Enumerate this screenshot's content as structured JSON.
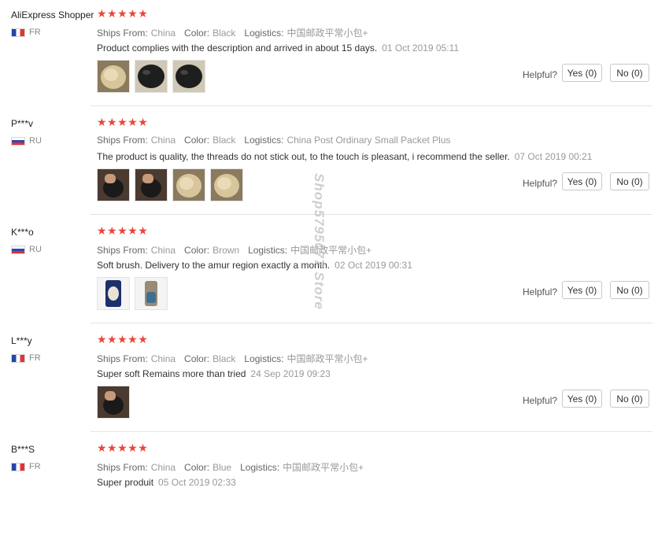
{
  "watermark": "Shop5795077 Store",
  "reviews": [
    {
      "user": "AliExpress Shopper",
      "country": "FR",
      "flag": "fr",
      "stars": "★★★★★",
      "ships_label": "Ships From:",
      "ships": "China",
      "color_label": "Color:",
      "color": "Black",
      "logistics_label": "Logistics:",
      "logistics": "中国邮政平常小包+",
      "text": "Product complies with the description and arrived in about 15 days.",
      "date": "01 Oct 2019 05:11",
      "photos": [
        "fleece-photo",
        "black-pad-photo",
        "black-pad-photo"
      ],
      "helpful_label": "Helpful?",
      "yes_label": "Yes (0)",
      "no_label": "No (0)"
    },
    {
      "user": "P***v",
      "country": "RU",
      "flag": "ru",
      "stars": "★★★★★",
      "ships_label": "Ships From:",
      "ships": "China",
      "color_label": "Color:",
      "color": "Black",
      "logistics_label": "Logistics:",
      "logistics": "China Post Ordinary Small Packet Plus",
      "text": "The product is quality, the threads do not stick out, to the touch is pleasant, i recommend the seller.",
      "date": "07 Oct 2019 00:21",
      "photos": [
        "hand-pad-photo",
        "hand-pad-photo",
        "fleece-photo",
        "fleece-photo"
      ],
      "helpful_label": "Helpful?",
      "yes_label": "Yes (0)",
      "no_label": "No (0)"
    },
    {
      "user": "K***o",
      "country": "RU",
      "flag": "ru",
      "stars": "★★★★★",
      "ships_label": "Ships From:",
      "ships": "China",
      "color_label": "Color:",
      "color": "Brown",
      "logistics_label": "Logistics:",
      "logistics": "中国邮政平常小包+",
      "text": "Soft brush. Delivery to the amur region exactly a month.",
      "date": "02 Oct 2019 00:31",
      "photos": [
        "phone-photo",
        "brush-photo"
      ],
      "helpful_label": "Helpful?",
      "yes_label": "Yes (0)",
      "no_label": "No (0)"
    },
    {
      "user": "L***y",
      "country": "FR",
      "flag": "fr",
      "stars": "★★★★★",
      "ships_label": "Ships From:",
      "ships": "China",
      "color_label": "Color:",
      "color": "Black",
      "logistics_label": "Logistics:",
      "logistics": "中国邮政平常小包+",
      "text": "Super soft Remains more than tried",
      "date": "24 Sep 2019 09:23",
      "photos": [
        "hand-pad-photo"
      ],
      "helpful_label": "Helpful?",
      "yes_label": "Yes (0)",
      "no_label": "No (0)"
    },
    {
      "user": "B***S",
      "country": "FR",
      "flag": "fr",
      "stars": "★★★★★",
      "ships_label": "Ships From:",
      "ships": "China",
      "color_label": "Color:",
      "color": "Blue",
      "logistics_label": "Logistics:",
      "logistics": "中国邮政平常小包+",
      "text": "Super produit",
      "date": "05 Oct 2019 02:33",
      "photos": [],
      "helpful_label": "",
      "yes_label": "",
      "no_label": ""
    }
  ]
}
